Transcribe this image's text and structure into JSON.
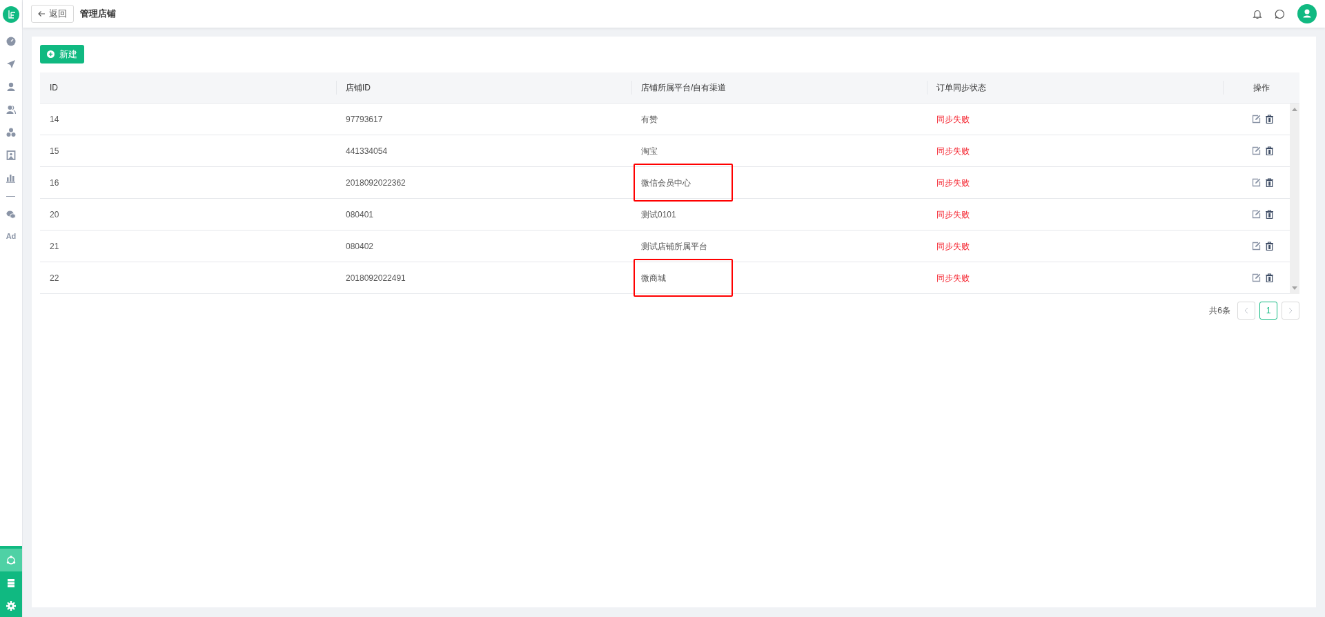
{
  "header": {
    "back_button": "返回",
    "title": "管理店铺"
  },
  "sidebar": {
    "items": [
      {
        "kind": "dashboard"
      },
      {
        "kind": "send"
      },
      {
        "kind": "user"
      },
      {
        "kind": "users"
      },
      {
        "kind": "cluster"
      },
      {
        "kind": "badge"
      },
      {
        "kind": "chart"
      },
      {
        "kind": "divider"
      },
      {
        "kind": "chat"
      },
      {
        "kind": "text",
        "label": "Ad"
      }
    ],
    "bottom_items": [
      {
        "kind": "network",
        "selected": true
      },
      {
        "kind": "server",
        "selected": false
      },
      {
        "kind": "gear",
        "selected": false
      }
    ]
  },
  "toolbar": {
    "new_button": "新建"
  },
  "table": {
    "columns": [
      "ID",
      "店铺ID",
      "店铺所属平台/自有渠道",
      "订单同步状态",
      "操作"
    ],
    "rows": [
      {
        "id": "14",
        "shop_id": "97793617",
        "platform": "有赞",
        "status": "同步失败",
        "highlighted": false
      },
      {
        "id": "15",
        "shop_id": "441334054",
        "platform": "淘宝",
        "status": "同步失败",
        "highlighted": false
      },
      {
        "id": "16",
        "shop_id": "2018092022362",
        "platform": "微信会员中心",
        "status": "同步失败",
        "highlighted": true
      },
      {
        "id": "20",
        "shop_id": "080401",
        "platform": "测试0101",
        "status": "同步失败",
        "highlighted": false
      },
      {
        "id": "21",
        "shop_id": "080402",
        "platform": "测试店铺所属平台",
        "status": "同步失败",
        "highlighted": false
      },
      {
        "id": "22",
        "shop_id": "2018092022491",
        "platform": "微商城",
        "status": "同步失败",
        "highlighted": true
      }
    ]
  },
  "pagination": {
    "total": "共6条",
    "pages": [
      {
        "label": "1",
        "selected": true
      }
    ]
  }
}
